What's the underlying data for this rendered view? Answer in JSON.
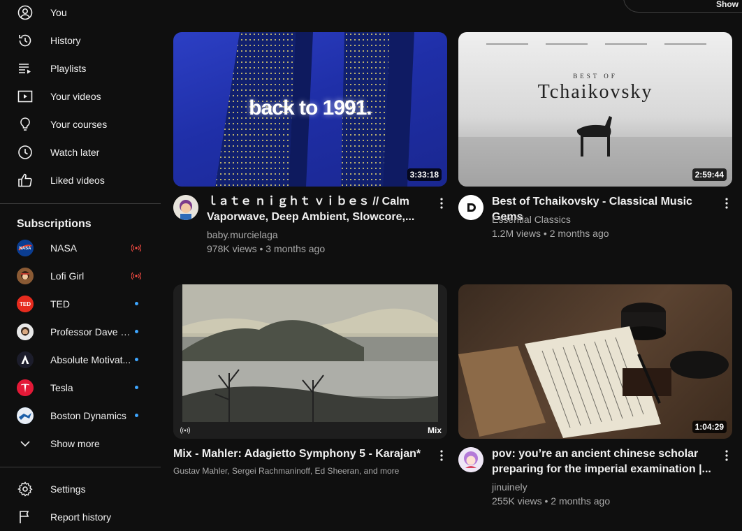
{
  "sidebar": {
    "you_items": [
      {
        "label": "You",
        "icon": "account-icon"
      },
      {
        "label": "History",
        "icon": "history-icon"
      },
      {
        "label": "Playlists",
        "icon": "playlists-icon"
      },
      {
        "label": "Your videos",
        "icon": "your-videos-icon"
      },
      {
        "label": "Your courses",
        "icon": "lightbulb-icon"
      },
      {
        "label": "Watch later",
        "icon": "clock-icon"
      },
      {
        "label": "Liked videos",
        "icon": "thumbs-up-icon"
      }
    ],
    "subscriptions_title": "Subscriptions",
    "subscriptions": [
      {
        "name": "NASA",
        "status": "live"
      },
      {
        "name": "Lofi Girl",
        "status": "live"
      },
      {
        "name": "TED",
        "status": "new"
      },
      {
        "name": "Professor Dave E...",
        "status": "new"
      },
      {
        "name": "Absolute Motivat...",
        "status": "new"
      },
      {
        "name": "Tesla",
        "status": "new"
      },
      {
        "name": "Boston Dynamics",
        "status": "new"
      }
    ],
    "show_more": "Show more",
    "settings": "Settings",
    "report_history": "Report history"
  },
  "top_chip": "Show",
  "videos": [
    {
      "thumb_text": "back to 1991.",
      "duration": "3:33:18",
      "title": "ｌａｔｅ ｎｉｇｈｔ ｖｉｂｅｓ // Calm Vaporwave, Deep Ambient, Slowcore,...",
      "channel": "baby.murcielaga",
      "meta": "978K views • 3 months ago"
    },
    {
      "thumb_caption_small": "BEST OF",
      "thumb_caption_big": "Tchaikovsky",
      "duration": "2:59:44",
      "title": "Best of Tchaikovsky - Classical Music Gems",
      "channel": "Essential Classics",
      "meta": "1.2M views • 2 months ago"
    },
    {
      "mix_label": "Mix",
      "title": "Mix - Mahler: Adagietto Symphony 5 - Karajan*",
      "channel": "Gustav Mahler, Sergei Rachmaninoff, Ed Sheeran, and more"
    },
    {
      "duration": "1:04:29",
      "title": "pov: you’re an ancient chinese scholar preparing for the imperial examination |...",
      "channel": "jinuinely",
      "meta": "255K views • 2 months ago"
    }
  ],
  "colors": {
    "background": "#0f0f0f",
    "live": "#ff4e45",
    "new_dot": "#3ea6ff"
  }
}
